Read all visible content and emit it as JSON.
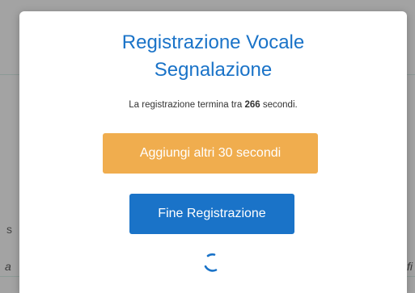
{
  "background": {
    "fragments": [
      "s",
      "a",
      "fi"
    ]
  },
  "modal": {
    "title_line1": "Registrazione Vocale",
    "title_line2": "Segnalazione",
    "countdown_prefix": "La registrazione termina tra",
    "countdown_value": "266",
    "countdown_suffix": "secondi.",
    "extend_button_label": "Aggiungi altri 30 secondi",
    "finish_button_label": "Fine Registrazione",
    "spinner_icon": "loading-spinner-icon"
  },
  "colors": {
    "title": "#1a73c8",
    "extend_button": "#f0ad4e",
    "finish_button": "#1a73c8"
  }
}
